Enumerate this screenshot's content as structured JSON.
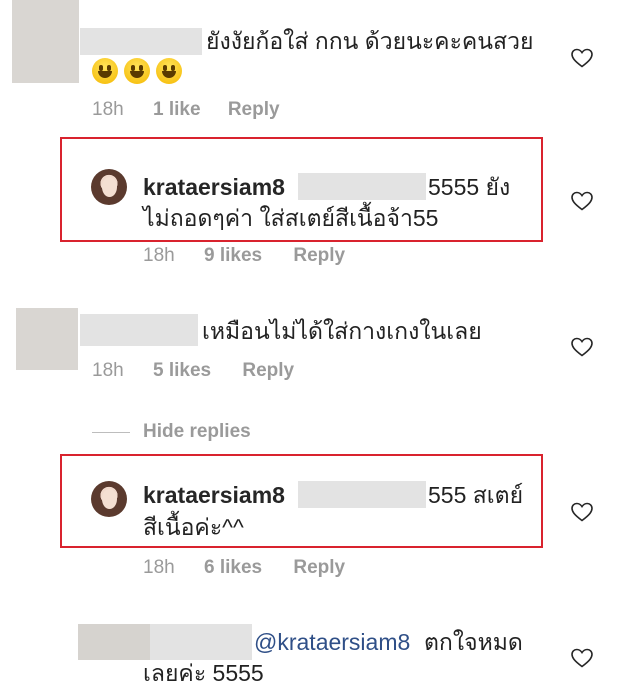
{
  "comments": [
    {
      "text": "ยังงัยก้อใส่ กกน ด้วยนะคะคนสวย",
      "emoji_icons": [
        "grinning-face-icon",
        "grinning-face-icon",
        "grinning-face-icon"
      ],
      "time": "18h",
      "likes": "1 like",
      "reply": "Reply"
    },
    {
      "username": "krataersiam8",
      "text_line1": "5555 ยัง",
      "text_line2": "ไม่ถอดๆค่า ใส่สเตย์สีเนื้อจ้า55",
      "time": "18h",
      "likes": "9 likes",
      "reply": "Reply"
    },
    {
      "text": "เหมือนไม่ได้ใส่กางเกงในเลย",
      "time": "18h",
      "likes": "5 likes",
      "reply": "Reply"
    },
    {
      "username": "krataersiam8",
      "text_line1": "555 สเตย์",
      "text_line2": "สีเนื้อค่ะ^^",
      "time": "18h",
      "likes": "6 likes",
      "reply": "Reply"
    },
    {
      "mention": "@krataersiam8",
      "text_line1": "ตกใจหมด",
      "text_line2": "เลยค่ะ 5555"
    }
  ],
  "hide_replies": "Hide replies",
  "colors": {
    "highlight_border": "#d9232e",
    "meta_gray": "#9a9a9a",
    "mention_blue": "#2f4f87"
  },
  "icons": {
    "like": "heart-outline-icon"
  }
}
